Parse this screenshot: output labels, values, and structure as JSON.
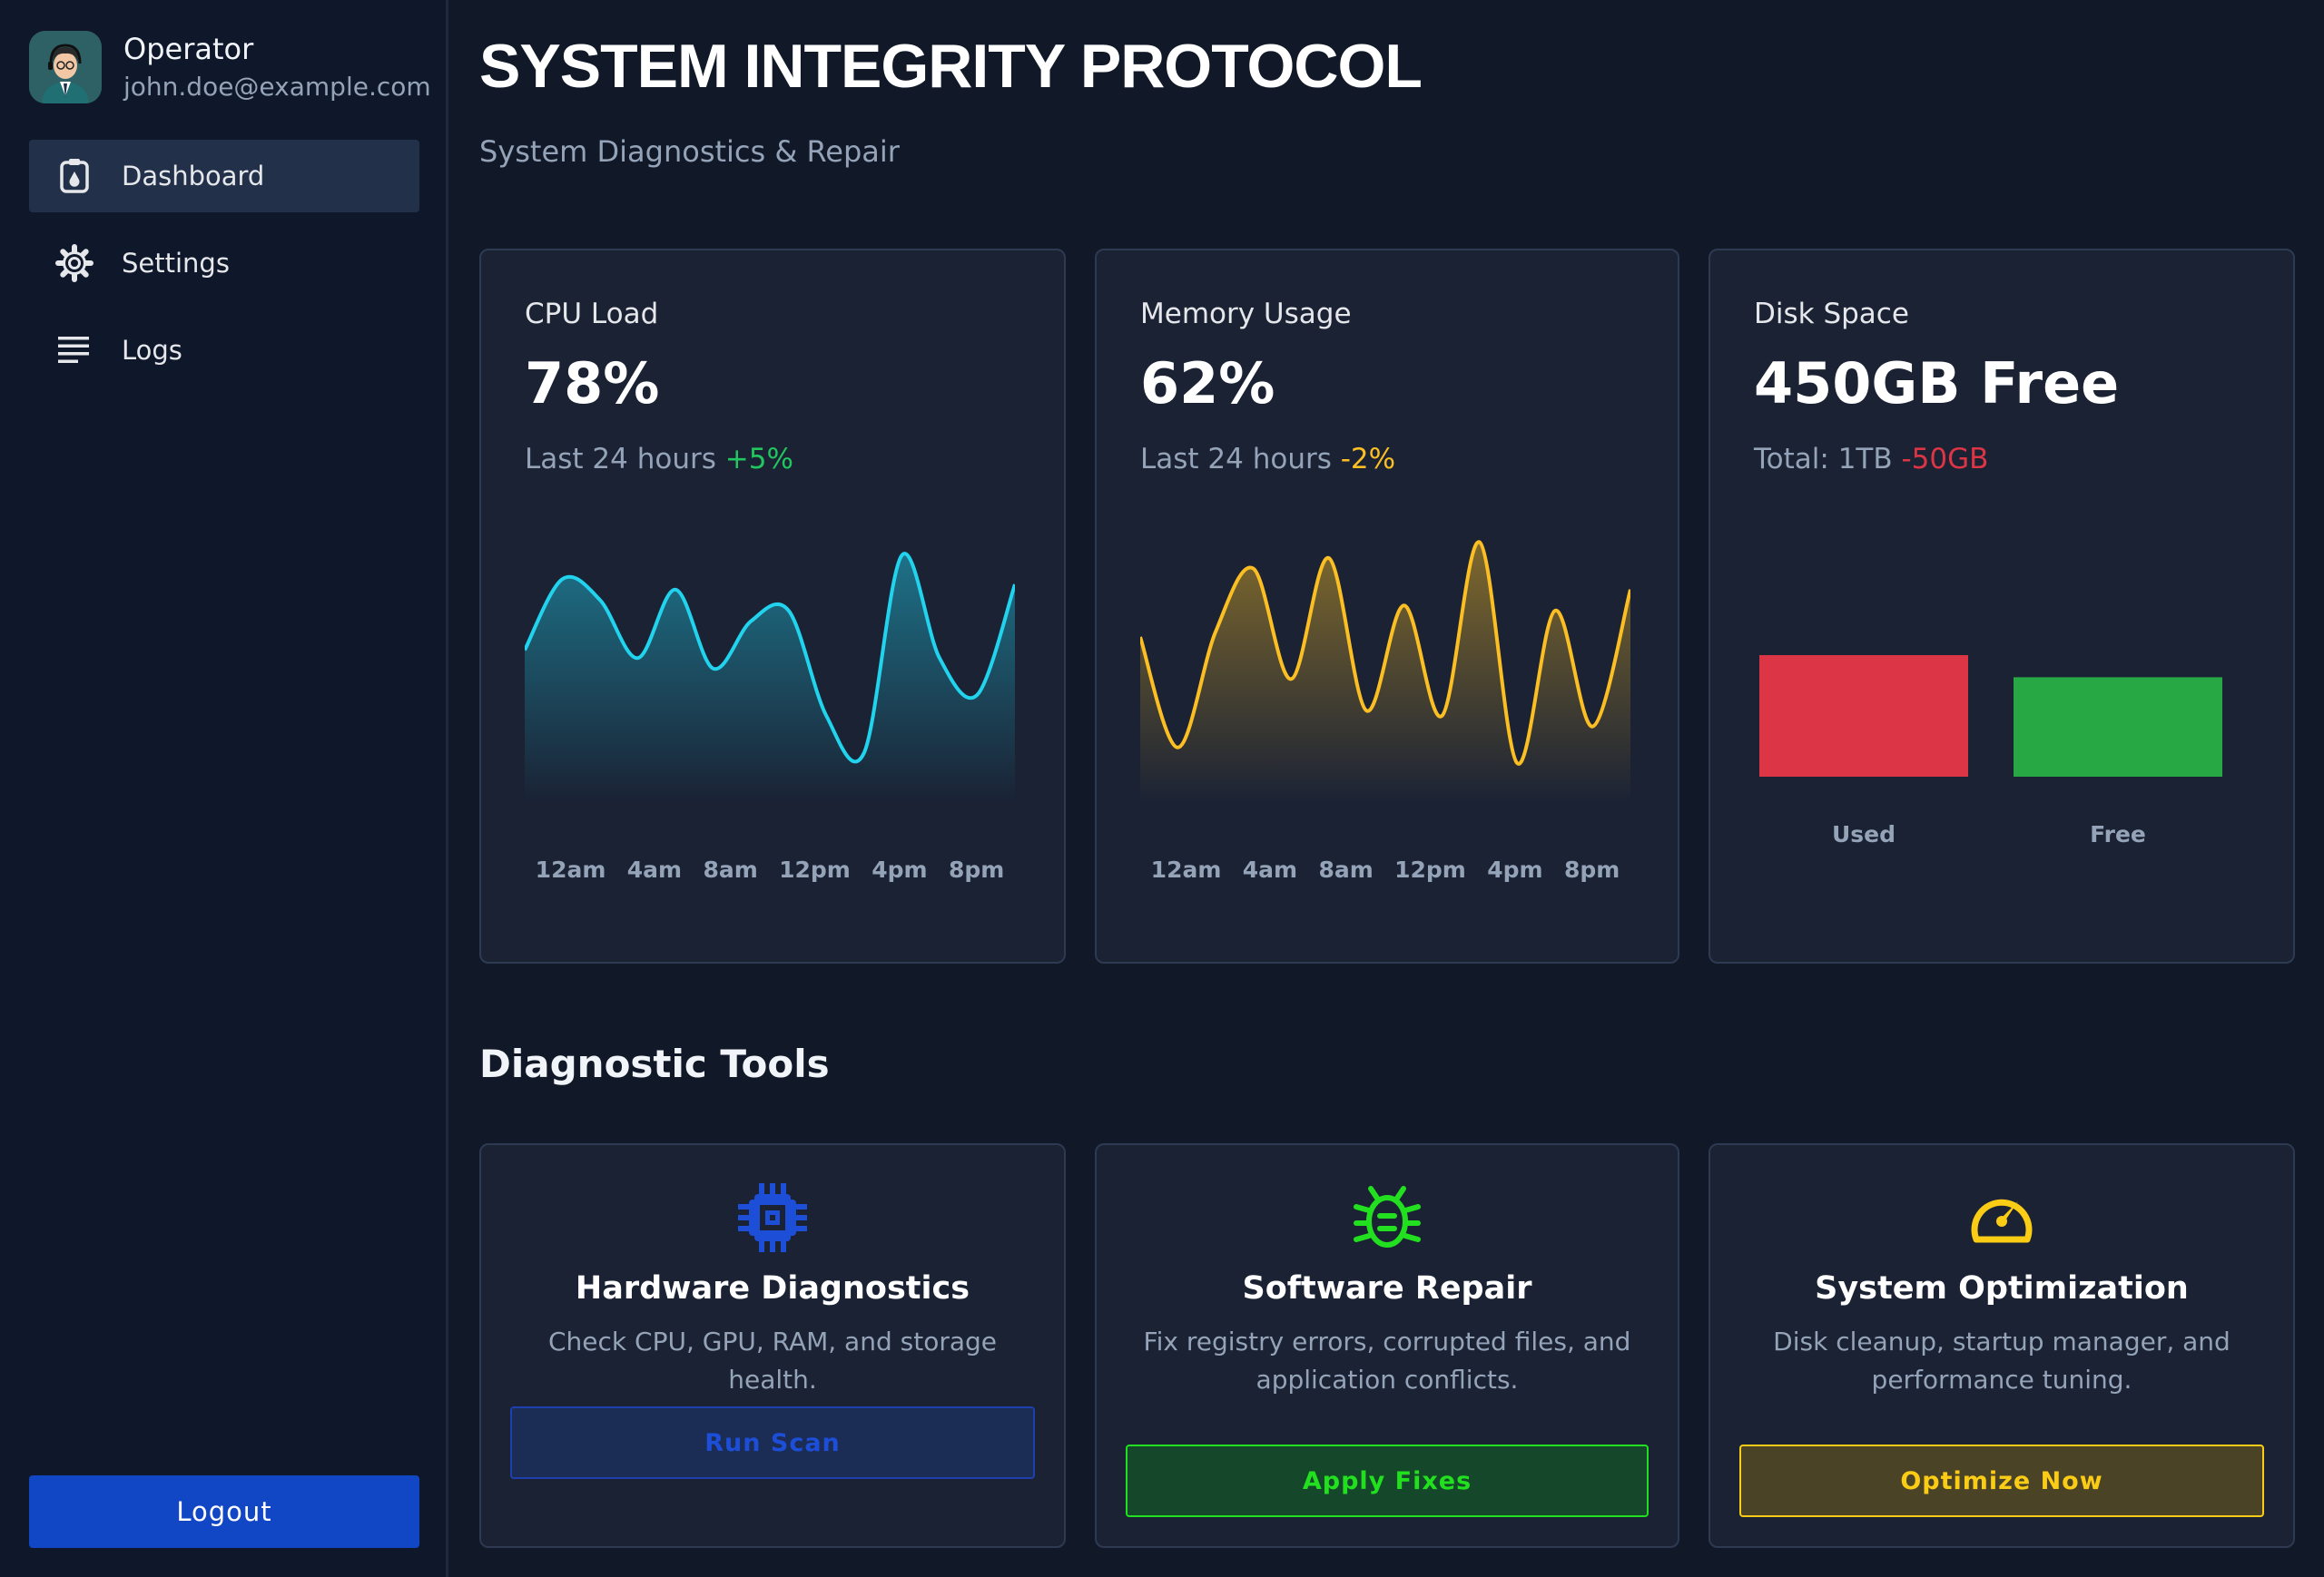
{
  "sidebar": {
    "user_name": "Operator",
    "user_email": "john.doe@example.com",
    "nav": [
      {
        "label": "Dashboard",
        "icon": "dashboard-icon"
      },
      {
        "label": "Settings",
        "icon": "gear-icon"
      },
      {
        "label": "Logs",
        "icon": "list-icon"
      }
    ],
    "logout_label": "Logout"
  },
  "header": {
    "title": "SYSTEM INTEGRITY PROTOCOL",
    "subtitle": "System Diagnostics & Repair"
  },
  "stats": {
    "cpu": {
      "label": "CPU Load",
      "value": "78%",
      "sub": "Last 24 hours",
      "change": "+5%",
      "change_color": "#22c55e"
    },
    "memory": {
      "label": "Memory Usage",
      "value": "62%",
      "sub": "Last 24 hours",
      "change": "-2%",
      "change_color": "#fbbf24"
    },
    "disk": {
      "label": "Disk Space",
      "value": "450GB Free",
      "sub": "Total: 1TB",
      "change": "-50GB",
      "change_color": "#dc3545"
    }
  },
  "chart_data": [
    {
      "type": "area",
      "x": [
        "12am",
        "4am",
        "8am",
        "12pm",
        "4pm",
        "8pm"
      ],
      "series": [
        {
          "values": [
            55,
            82,
            74,
            52,
            78,
            48,
            66,
            70,
            30,
            16,
            91,
            52,
            38,
            80
          ],
          "color": "#22d3ee"
        }
      ],
      "ylim": [
        0,
        100
      ]
    },
    {
      "type": "area",
      "x": [
        "12am",
        "4am",
        "8am",
        "12pm",
        "4pm",
        "8pm"
      ],
      "series": [
        {
          "values": [
            60,
            18,
            62,
            86,
            44,
            90,
            32,
            72,
            30,
            96,
            12,
            70,
            26,
            78
          ],
          "color": "#fbbf24"
        }
      ],
      "ylim": [
        0,
        100
      ]
    },
    {
      "type": "bar",
      "categories": [
        "Used",
        "Free"
      ],
      "values": [
        550,
        450
      ],
      "colors": [
        "#dc3545",
        "#28a745"
      ]
    }
  ],
  "tools_section_title": "Diagnostic Tools",
  "tools": [
    {
      "title": "Hardware Diagnostics",
      "desc": "Check CPU, GPU, RAM, and storage health.",
      "button": "Run Scan",
      "icon": "chip-icon",
      "color": "#1d4ed8"
    },
    {
      "title": "Software Repair",
      "desc": "Fix registry errors, corrupted files, and application conflicts.",
      "button": "Apply Fixes",
      "icon": "bug-icon",
      "color": "#22e01f"
    },
    {
      "title": "System Optimization",
      "desc": "Disk cleanup, startup manager, and performance tuning.",
      "button": "Optimize Now",
      "icon": "speedometer-icon",
      "color": "#facc15"
    }
  ]
}
